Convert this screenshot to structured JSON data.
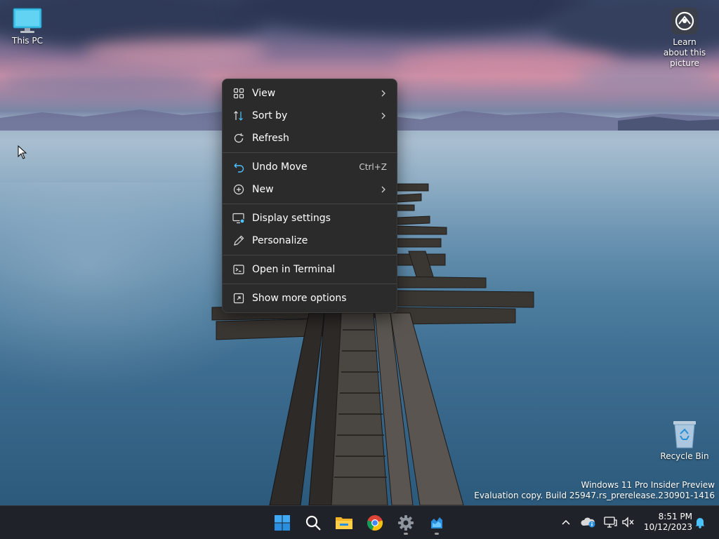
{
  "desktop": {
    "icons": {
      "this_pc": {
        "label": "This PC",
        "icon": "monitor-icon"
      },
      "recycle_bin": {
        "label": "Recycle Bin",
        "icon": "recycle-bin-icon"
      },
      "learn_picture": {
        "label": "Learn about this picture",
        "icon": "camera-icon"
      }
    },
    "watermark": {
      "line1": "Windows 11 Pro Insider Preview",
      "line2": "Evaluation copy. Build 25947.rs_prerelease.230901-1416"
    }
  },
  "context_menu": {
    "items": [
      {
        "label": "View",
        "icon": "grid-icon",
        "submenu": true,
        "shortcut": ""
      },
      {
        "label": "Sort by",
        "icon": "sort-icon",
        "submenu": true,
        "shortcut": ""
      },
      {
        "label": "Refresh",
        "icon": "refresh-icon",
        "submenu": false,
        "shortcut": ""
      },
      {
        "label": "Undo Move",
        "icon": "undo-icon",
        "submenu": false,
        "shortcut": "Ctrl+Z"
      },
      {
        "label": "New",
        "icon": "plus-circle-icon",
        "submenu": true,
        "shortcut": ""
      },
      {
        "label": "Display settings",
        "icon": "display-icon",
        "submenu": false,
        "shortcut": ""
      },
      {
        "label": "Personalize",
        "icon": "pen-icon",
        "submenu": false,
        "shortcut": ""
      },
      {
        "label": "Open in Terminal",
        "icon": "terminal-icon",
        "submenu": false,
        "shortcut": ""
      },
      {
        "label": "Show more options",
        "icon": "more-options-icon",
        "submenu": false,
        "shortcut": ""
      }
    ]
  },
  "taskbar": {
    "apps": [
      {
        "name": "Start",
        "icon": "windows-start-icon"
      },
      {
        "name": "Search",
        "icon": "search-icon"
      },
      {
        "name": "File Explorer",
        "icon": "folder-icon"
      },
      {
        "name": "Google Chrome",
        "icon": "chrome-icon"
      },
      {
        "name": "Settings",
        "icon": "gear-icon"
      },
      {
        "name": "App",
        "icon": "app-icon"
      }
    ],
    "tray": {
      "time": "8:51 PM",
      "date": "10/12/2023"
    }
  },
  "colors": {
    "menu_bg": "#2b2b2b",
    "taskbar_bg": "#1f2228",
    "accent_blue": "#4cc2ff"
  }
}
